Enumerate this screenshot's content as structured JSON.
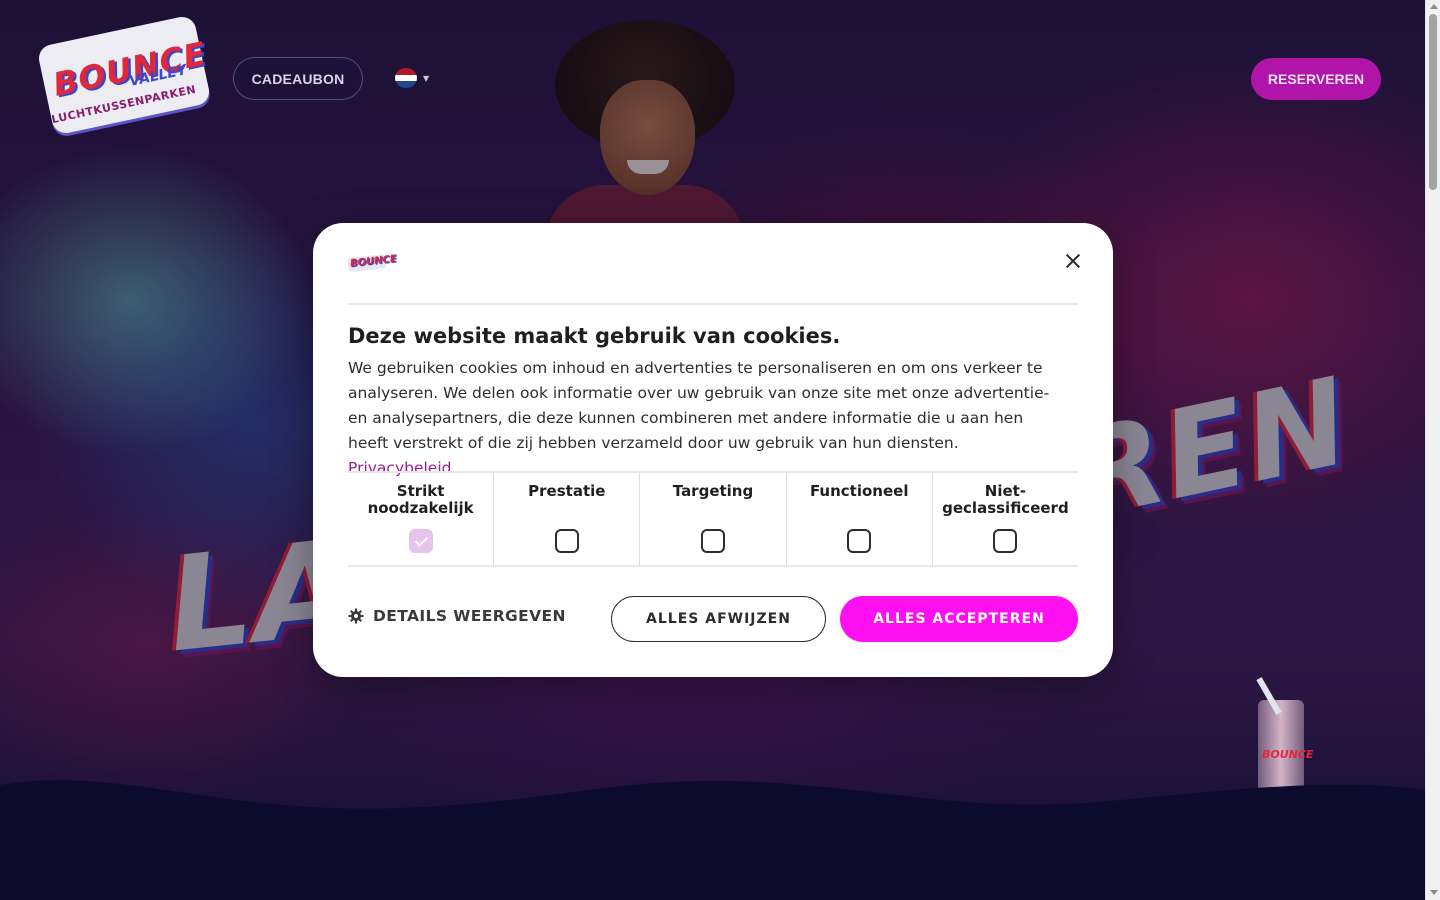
{
  "header": {
    "logo": {
      "line1": "BOUNCE",
      "line2": "VALLEY",
      "line3": "LUCHTKUSSENPARKEN"
    },
    "gift_card_label": "CADEAUBON",
    "language": {
      "selected_flag": "nl-flag-icon"
    },
    "reserve_label": "RESERVEREN"
  },
  "hero": {
    "word_left": "LA",
    "word_right": "REN",
    "cup_logo": "BOUNCE"
  },
  "cookie_dialog": {
    "logo_text": "BOUNCE",
    "title": "Deze website maakt gebruik van cookies.",
    "body": "We gebruiken cookies om inhoud en advertenties te personaliseren en om ons verkeer te analyseren. We delen ook informatie over uw gebruik van onze site met onze advertentie- en analysepartners, die deze kunnen combineren met andere informatie die u aan hen heeft verstrekt of die zij hebben verzameld door uw gebruik van hun diensten.",
    "privacy_link": "Privacybeleid",
    "categories": [
      {
        "label": "Strikt noodzakelijk",
        "checked": true
      },
      {
        "label": "Prestatie",
        "checked": false
      },
      {
        "label": "Targeting",
        "checked": false
      },
      {
        "label": "Functioneel",
        "checked": false
      },
      {
        "label": "Niet-geclassificeerd",
        "checked": false
      }
    ],
    "details_label": "DETAILS WEERGEVEN",
    "reject_label": "ALLES AFWIJZEN",
    "accept_label": "ALLES ACCEPTEREN"
  },
  "colors": {
    "accent_pink": "#ff10f0",
    "reserve_purple": "#b014a8",
    "link_purple": "#9a1a9a",
    "page_navy": "#0c0b2e"
  }
}
